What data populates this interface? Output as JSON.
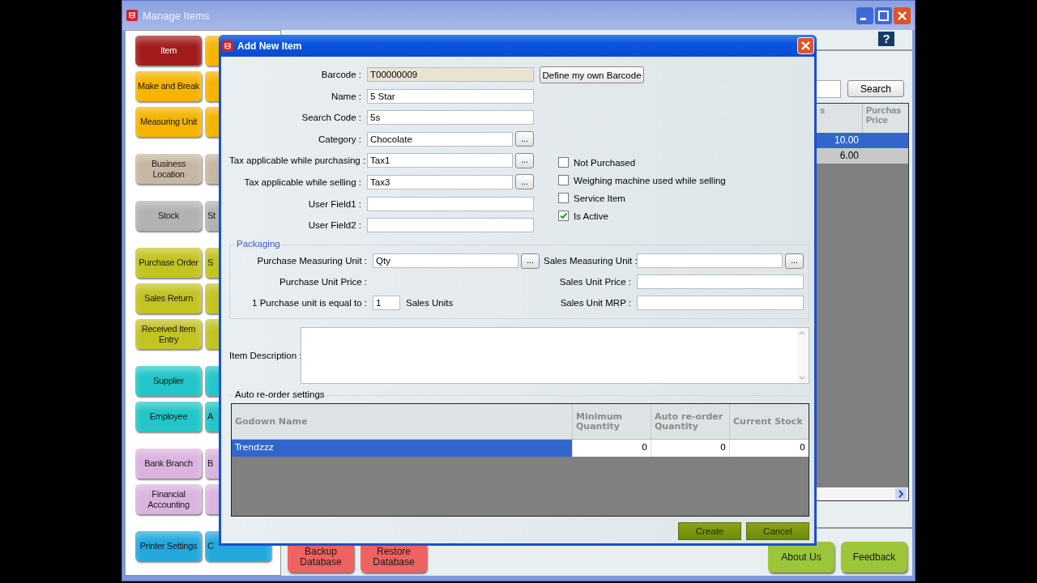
{
  "window": {
    "title": "Manage Items"
  },
  "sidebar": {
    "buttons": [
      {
        "label": "Item",
        "color": "#a31b1b"
      },
      {
        "label": "Make and Break",
        "color": "#f5b400"
      },
      {
        "label": "Measuring Unit",
        "color": "#f5b400"
      },
      {
        "label": "Business Location",
        "color": "#c6b7a2"
      },
      {
        "label": "Stock",
        "color": "#b2b2b2"
      },
      {
        "label": "Purchase Order",
        "color": "#c3c322"
      },
      {
        "label": "Sales Return",
        "color": "#c3c322"
      },
      {
        "label": "Received Item Entry",
        "color": "#c3c322"
      },
      {
        "label": "Supplier",
        "color": "#22c6c8"
      },
      {
        "label": "Employee",
        "color": "#22c6c8"
      },
      {
        "label": "Bank Branch",
        "color": "#dab4de"
      },
      {
        "label": "Financial Accounting",
        "color": "#dab4de"
      },
      {
        "label": "Printer Settings",
        "color": "#22a8dc"
      }
    ],
    "buttons_column_2": [
      {
        "color": "#f5b400"
      },
      {
        "color": "#f5b400"
      },
      {
        "color": "#f5b400"
      },
      {
        "color": "#c6b7a2"
      },
      {
        "label": "St",
        "color": "#b2b2b2"
      },
      {
        "label": "S",
        "color": "#c3c322"
      },
      {
        "color": "#c3c322"
      },
      {
        "color": "#c3c322"
      },
      {
        "color": "#22c6c8"
      },
      {
        "label": "A",
        "color": "#22c6c8"
      },
      {
        "label": "B",
        "color": "#dab4de"
      },
      {
        "color": "#dab4de"
      },
      {
        "label": "C",
        "color": "#22a8dc"
      }
    ]
  },
  "items_panel": {
    "help_icon": "?",
    "search_button": "Search",
    "columns": [
      "s",
      "Purchas Price"
    ],
    "rows": [
      {
        "cells": [
          "10.00",
          ""
        ],
        "selected": true
      },
      {
        "cells": [
          "6.00",
          ""
        ],
        "selected": false
      }
    ]
  },
  "bottom_buttons": [
    {
      "label": "Backup Database",
      "color": "#f06262"
    },
    {
      "label": "Restore Database",
      "color": "#f06262"
    },
    {
      "label": "About Us",
      "color": "#9cc53a"
    },
    {
      "label": "Feedback",
      "color": "#9cc53a"
    }
  ],
  "dialog": {
    "title": "Add New Item",
    "fields": [
      {
        "label": "Barcode :",
        "value": "T00000009",
        "kind": "readonly"
      },
      {
        "label": "Name :",
        "value": "5 Star",
        "kind": "text"
      },
      {
        "label": "Search Code :",
        "value": "5s",
        "kind": "text"
      },
      {
        "label": "Category :",
        "value": "Chocolate",
        "kind": "picker",
        "button": "..."
      },
      {
        "label": "Tax applicable while purchasing :",
        "value": "Tax1",
        "kind": "picker",
        "button": "..."
      },
      {
        "label": "Tax applicable while selling :",
        "value": "Tax3",
        "kind": "picker",
        "button": "..."
      },
      {
        "label": "User Field1 :",
        "kind": "text"
      },
      {
        "label": "User Field2 :",
        "kind": "text"
      }
    ],
    "barcode_button": "Define my own Barcode",
    "options": [
      {
        "label": "Not Purchased",
        "checked": false
      },
      {
        "label": "Weighing machine used while selling",
        "checked": false
      },
      {
        "label": "Service Item",
        "checked": false
      },
      {
        "label": "Is Active",
        "checked": true
      }
    ],
    "packaging": {
      "title": "Packaging",
      "left": [
        {
          "label": "Purchase Measuring Unit :",
          "value": "Qty",
          "kind": "picker",
          "button": "..."
        },
        {
          "label": "Purchase Unit Price :",
          "kind": "label"
        },
        {
          "label": "1 Purchase unit is equal to :",
          "value": "1",
          "kind": "unit",
          "suffix": "Sales Units"
        }
      ],
      "right": [
        {
          "label": "Sales Measuring Unit :",
          "kind": "picker",
          "button": "..."
        },
        {
          "label": "Sales Unit Price :",
          "kind": "text"
        },
        {
          "label": "Sales Unit MRP :",
          "kind": "text"
        }
      ]
    },
    "description": {
      "label": "Item Description :"
    },
    "reorder": {
      "title": "Auto re-order settings",
      "columns": [
        "Godown Name",
        "Minimum Quantity",
        "Auto re-order Quantity",
        "Current Stock"
      ],
      "rows": [
        {
          "cells": [
            "Trendzzz",
            "0",
            "0",
            "0"
          ],
          "selected": true
        }
      ]
    },
    "buttons": [
      "Create",
      "Cancel"
    ]
  }
}
